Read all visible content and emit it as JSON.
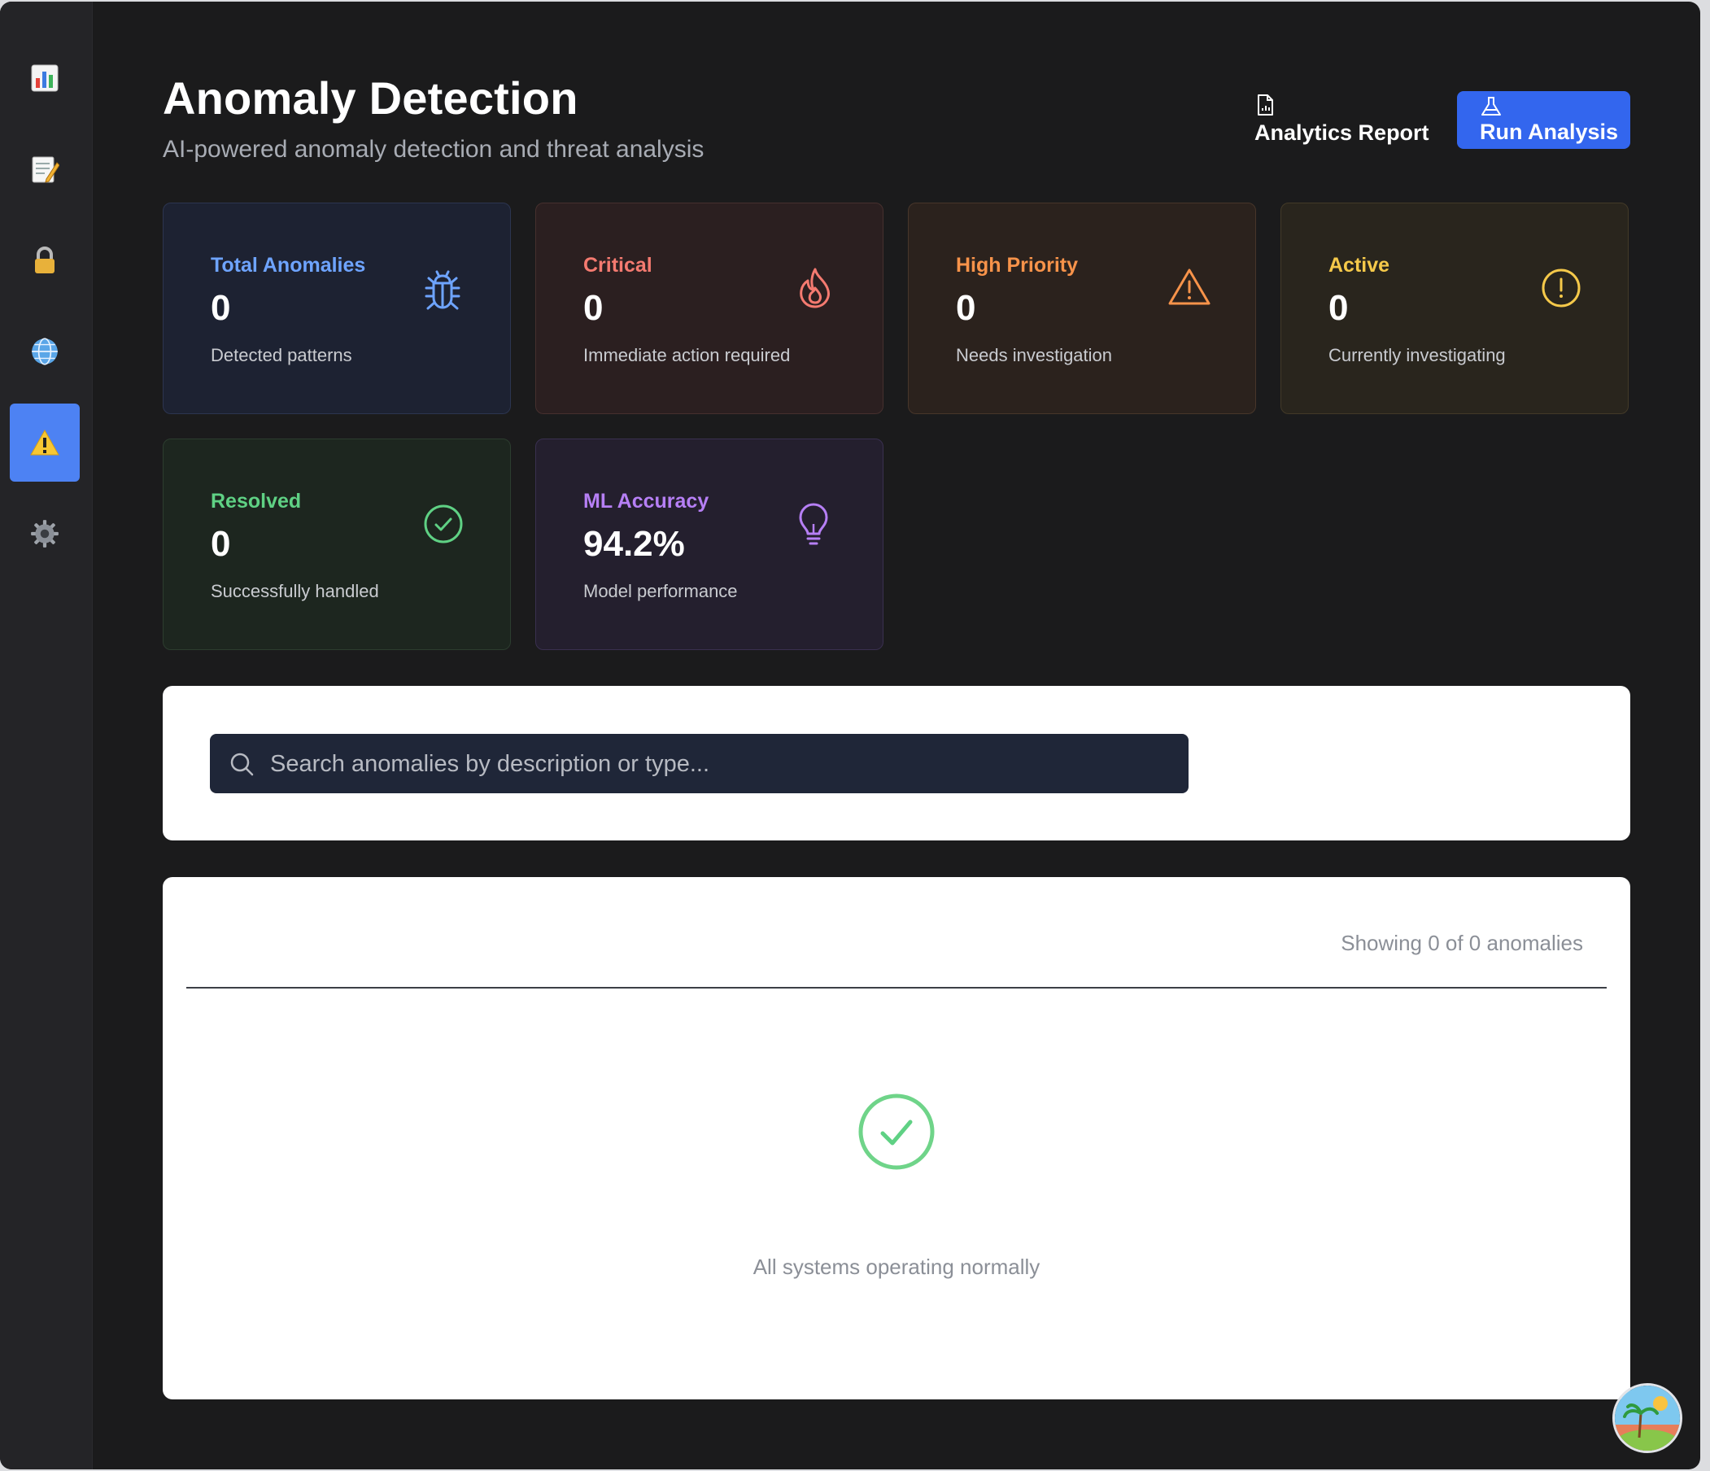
{
  "sidebar": {
    "items": [
      {
        "name": "dashboard",
        "icon": "bar-chart-icon"
      },
      {
        "name": "logs",
        "icon": "memo-icon"
      },
      {
        "name": "security",
        "icon": "lock-icon"
      },
      {
        "name": "network",
        "icon": "globe-icon"
      },
      {
        "name": "anomalies",
        "icon": "warning-icon",
        "active": true
      },
      {
        "name": "settings",
        "icon": "gear-icon"
      }
    ]
  },
  "header": {
    "title": "Anomaly Detection",
    "subtitle": "AI-powered anomaly detection and threat analysis",
    "report_label": "Analytics Report",
    "run_label": "Run Analysis"
  },
  "stats": {
    "total": {
      "label": "Total Anomalies",
      "value": "0",
      "desc": "Detected patterns",
      "color": "#6ea4ff"
    },
    "critical": {
      "label": "Critical",
      "value": "0",
      "desc": "Immediate action required",
      "color": "#f47a70"
    },
    "high": {
      "label": "High Priority",
      "value": "0",
      "desc": "Needs investigation",
      "color": "#f7934a"
    },
    "active": {
      "label": "Active",
      "value": "0",
      "desc": "Currently investigating",
      "color": "#f5c94a"
    },
    "resolved": {
      "label": "Resolved",
      "value": "0",
      "desc": "Successfully handled",
      "color": "#5fd184"
    },
    "ml": {
      "label": "ML Accuracy",
      "value": "94.2%",
      "desc": "Model performance",
      "color": "#b67ff5"
    }
  },
  "search": {
    "placeholder": "Search anomalies by description or type...",
    "value": ""
  },
  "results": {
    "showing": "Showing 0 of 0 anomalies",
    "empty_message": "All systems operating normally"
  },
  "colors": {
    "accent": "#3366ee",
    "sidebar_active": "#4d82f3",
    "success": "#5fd184"
  }
}
